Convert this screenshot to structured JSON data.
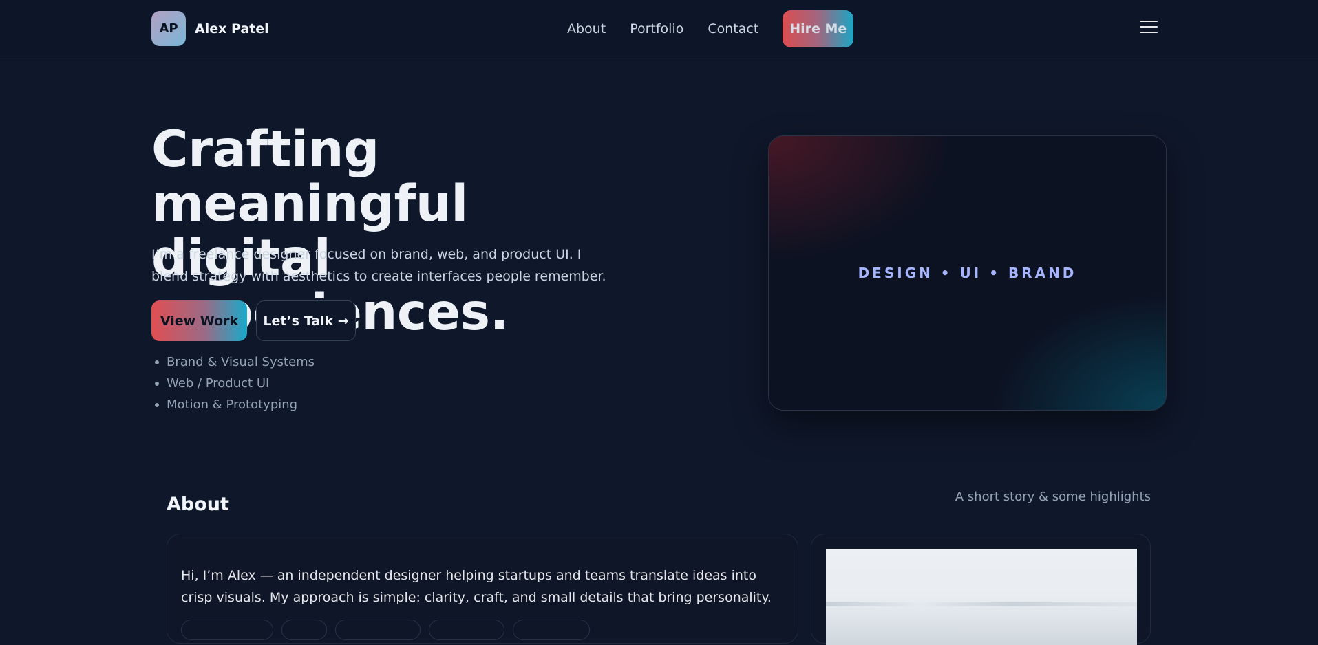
{
  "header": {
    "logo_initials": "AP",
    "brand_name": "Alex Patel",
    "nav": [
      "About",
      "Portfolio",
      "Contact"
    ],
    "cta_label": "Hire Me",
    "menu_icon": "hamburger-menu-icon"
  },
  "hero": {
    "title_line1": "Crafting meaningful",
    "title_line2": "digital experiences.",
    "description": "I’m a freelance designer focused on brand, web, and product UI. I blend strategy with aesthetics to create interfaces people remember.",
    "primary_button": "View Work",
    "secondary_button": "Let’s Talk →",
    "skills": [
      "Brand & Visual Systems",
      "Web / Product UI",
      "Motion & Prototyping"
    ],
    "card_text": "DESIGN • UI • BRAND"
  },
  "about": {
    "title": "About",
    "subtitle": "A short story & some highlights",
    "intro": "Hi, I’m Alex — an independent designer helping startups and teams translate ideas into crisp visuals. My approach is simple: clarity, craft, and small details that bring personality."
  },
  "colors": {
    "background": "#0f172a",
    "accent_start": "#dc4d4f",
    "accent_end": "#1ba6c4",
    "card_label": "#a5b4fc"
  }
}
